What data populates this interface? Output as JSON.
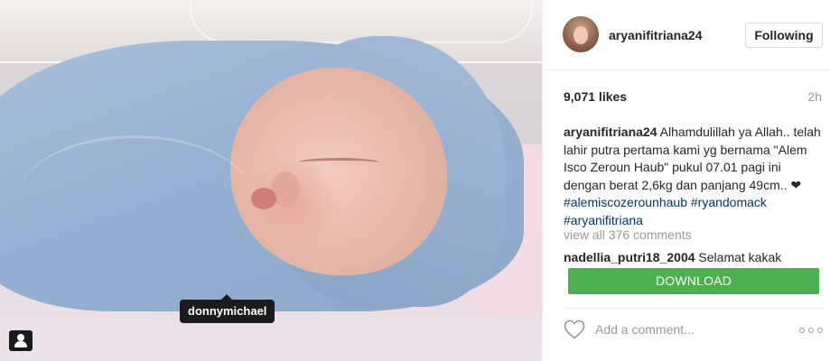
{
  "photo": {
    "tagged_user": "donnymichael"
  },
  "post": {
    "username": "aryanifitriana24",
    "follow_label": "Following",
    "likes": "9,071 likes",
    "time_ago": "2h",
    "caption": {
      "username": "aryanifitriana24",
      "text": " Alhamdulillah ya Allah.. telah lahir putra pertama kami yg bernama \"Alem Isco Zeroun Haub\" pukul 07.01 pagi ini dengan berat 2,6kg dan panjang 49cm.. ❤ ",
      "hashtags": [
        "#alemiscozerounhaub",
        "#ryandomack",
        "#aryanifitriana"
      ]
    },
    "view_all_comments": "view all 376 comments",
    "comments": [
      {
        "username": "nadellia_putri18_2004",
        "text": " Selamat kakak"
      }
    ],
    "download_label": "DOWNLOAD",
    "comment_placeholder": "Add a comment...",
    "accent_color": "#4caf50",
    "hashtag_color": "#003569"
  }
}
